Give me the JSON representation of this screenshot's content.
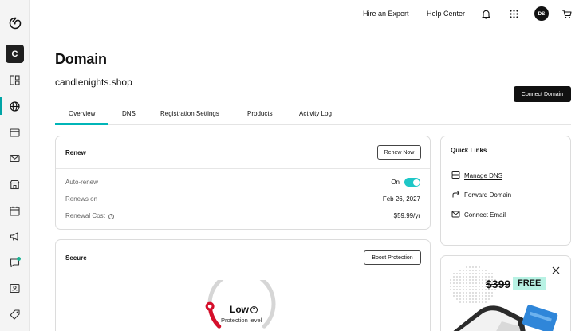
{
  "sidebar": {
    "account_initial": "C",
    "items": [
      {
        "icon": "dashboard-icon"
      },
      {
        "icon": "globe-icon",
        "active": true
      },
      {
        "icon": "browser-window-icon"
      },
      {
        "icon": "mail-icon"
      },
      {
        "icon": "store-icon"
      },
      {
        "icon": "calendar-icon"
      },
      {
        "icon": "megaphone-icon"
      },
      {
        "icon": "chat-icon",
        "has_notification": true
      },
      {
        "icon": "contact-card-icon"
      },
      {
        "icon": "tag-icon"
      }
    ]
  },
  "header": {
    "hire_expert": "Hire an Expert",
    "help_center": "Help Center",
    "user_initials": "DS"
  },
  "page": {
    "title": "Domain",
    "domain_name": "candlenights.shop",
    "connect_button": "Connect Domain"
  },
  "tabs": [
    {
      "label": "Overview",
      "active": true
    },
    {
      "label": "DNS"
    },
    {
      "label": "Registration Settings"
    },
    {
      "label": "Products"
    },
    {
      "label": "Activity Log"
    }
  ],
  "renew": {
    "title": "Renew",
    "button": "Renew Now",
    "auto_renew_label": "Auto-renew",
    "auto_renew_value": "On",
    "auto_renew_on": true,
    "renews_on_label": "Renews on",
    "renews_on_value": "Feb 26, 2027",
    "cost_label": "Renewal Cost",
    "cost_value": "$59.99/yr"
  },
  "secure": {
    "title": "Secure",
    "button": "Boost Protection",
    "level": "Low",
    "level_caption": "Protection level",
    "level_fraction": 0.15
  },
  "quick_links": {
    "title": "Quick Links",
    "items": [
      {
        "label": "Manage DNS",
        "icon": "server-icon"
      },
      {
        "label": "Forward Domain",
        "icon": "forward-arrow-icon"
      },
      {
        "label": "Connect Email",
        "icon": "mail-icon"
      }
    ]
  },
  "promo": {
    "old_price": "$399",
    "badge": "FREE"
  },
  "colors": {
    "accent": "#00b5b8",
    "toggle": "#1ec7c7",
    "gauge_red": "#d50f2b",
    "free_badge": "#b8f2e4"
  }
}
